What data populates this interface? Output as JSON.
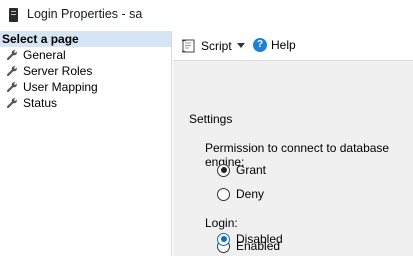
{
  "window": {
    "title": "Login Properties - sa"
  },
  "sidebar": {
    "header": "Select a page",
    "items": [
      {
        "label": "General"
      },
      {
        "label": "Server Roles"
      },
      {
        "label": "User Mapping"
      },
      {
        "label": "Status"
      }
    ]
  },
  "toolbar": {
    "script_label": "Script",
    "help_label": "Help",
    "help_icon": "?"
  },
  "content": {
    "section": "Settings",
    "permission_label": "Permission to connect to database engine:",
    "permission_options": [
      {
        "label": "Grant",
        "selected": true
      },
      {
        "label": "Deny",
        "selected": false
      }
    ],
    "login_label": "Login:",
    "login_options": [
      {
        "label": "Enabled",
        "selected": false
      },
      {
        "label": "Disabled",
        "selected": true
      }
    ]
  }
}
